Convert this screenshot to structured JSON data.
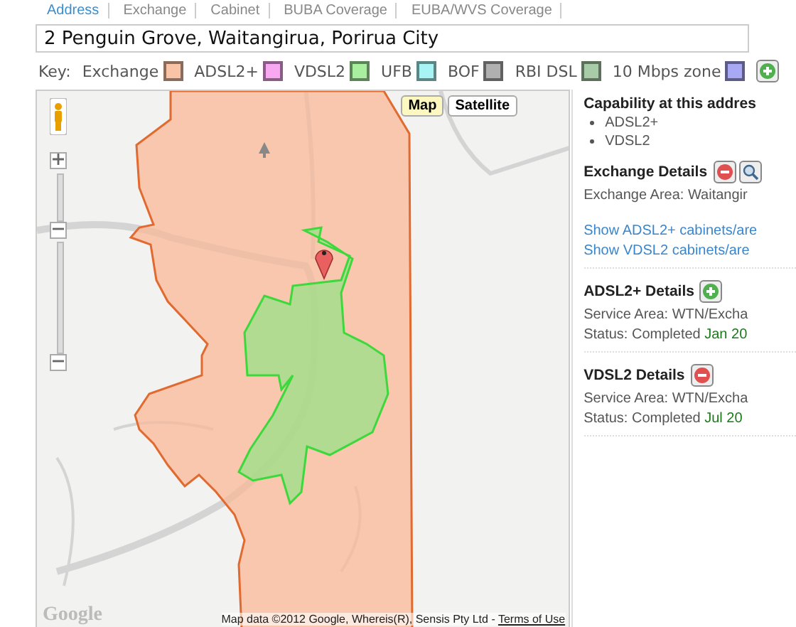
{
  "tabs": [
    {
      "label": "Address",
      "selected": true
    },
    {
      "label": "Exchange",
      "selected": false
    },
    {
      "label": "Cabinet",
      "selected": false
    },
    {
      "label": "BUBA Coverage",
      "selected": false
    },
    {
      "label": "EUBA/WVS Coverage",
      "selected": false
    }
  ],
  "address": {
    "value": "2 Penguin Grove, Waitangirua, Porirua City"
  },
  "key": {
    "label": "Key:",
    "items": [
      {
        "label": "Exchange",
        "color": "#f9c4a6"
      },
      {
        "label": "ADSL2+",
        "color": "#f7a8f0"
      },
      {
        "label": "VDSL2",
        "color": "#a8f0a0"
      },
      {
        "label": "UFB",
        "color": "#a8f4f4"
      },
      {
        "label": "BOF",
        "color": "#b0b0b0"
      },
      {
        "label": "RBI DSL",
        "color": "#a8cca8"
      },
      {
        "label": "10 Mbps zone",
        "color": "#a8a8f4"
      }
    ]
  },
  "map": {
    "map_types": [
      {
        "label": "Map",
        "selected": true
      },
      {
        "label": "Satellite",
        "selected": false
      }
    ],
    "attribution": "Map data ©2012 Google, Whereis(R), Sensis Pty Ltd - ",
    "terms_link": "Terms of Use",
    "logo": "Google"
  },
  "panel": {
    "capability": {
      "title": "Capability at this addres",
      "items": [
        "ADSL2+",
        "VDSL2"
      ]
    },
    "sections": [
      {
        "title": "Exchange Details",
        "buttons": [
          {
            "kind": "collapse"
          },
          {
            "kind": "search"
          }
        ],
        "lines": [
          {
            "text": "Exchange Area: Waitangir"
          }
        ],
        "links": [
          "Show ADSL2+ cabinets/are",
          "Show VDSL2 cabinets/are"
        ]
      },
      {
        "title": "ADSL2+ Details",
        "buttons": [
          {
            "kind": "expand"
          }
        ],
        "lines": [
          {
            "text": "Service Area: WTN/Excha"
          },
          {
            "text": "Status: Completed",
            "date": "Jan 20"
          }
        ]
      },
      {
        "title": "VDSL2 Details",
        "buttons": [
          {
            "kind": "collapse"
          }
        ],
        "lines": [
          {
            "text": "Service Area: WTN/Excha"
          },
          {
            "text": "Status: Completed",
            "date": "Jul 20"
          }
        ]
      }
    ]
  }
}
